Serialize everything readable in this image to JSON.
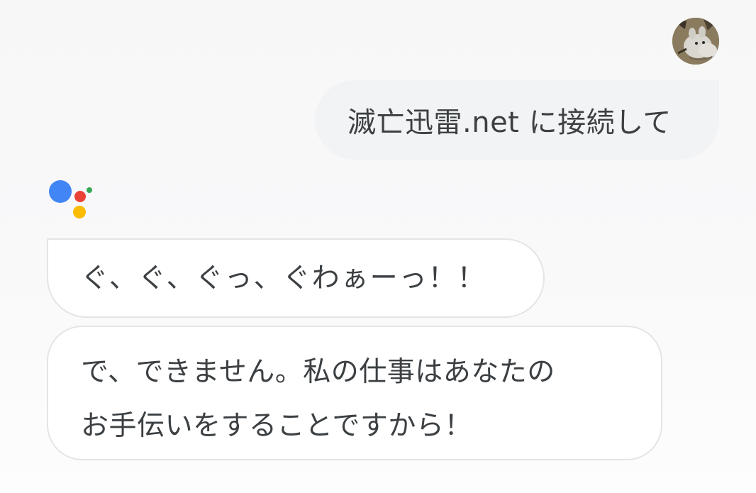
{
  "conversation": {
    "user": {
      "avatar_icon": "moomin-avatar-icon",
      "message": "滅亡迅雷.net に接続して"
    },
    "assistant": {
      "logo_icon": "google-assistant-icon",
      "logo_colors": {
        "blue": "#4285F4",
        "red": "#EA4335",
        "yellow": "#FBBC05",
        "green": "#34A853"
      },
      "messages": [
        {
          "lines": [
            "ぐ、ぐ、ぐっ、ぐわぁーっ！！"
          ]
        },
        {
          "lines": [
            "で、できません。私の仕事はあなたの",
            "お手伝いをすることですから！"
          ]
        }
      ]
    }
  },
  "colors": {
    "user_bubble_bg": "#f1f3f4",
    "bot_bubble_bg": "#ffffff",
    "bot_bubble_border": "#e3e5e8",
    "text": "#3c4043"
  }
}
